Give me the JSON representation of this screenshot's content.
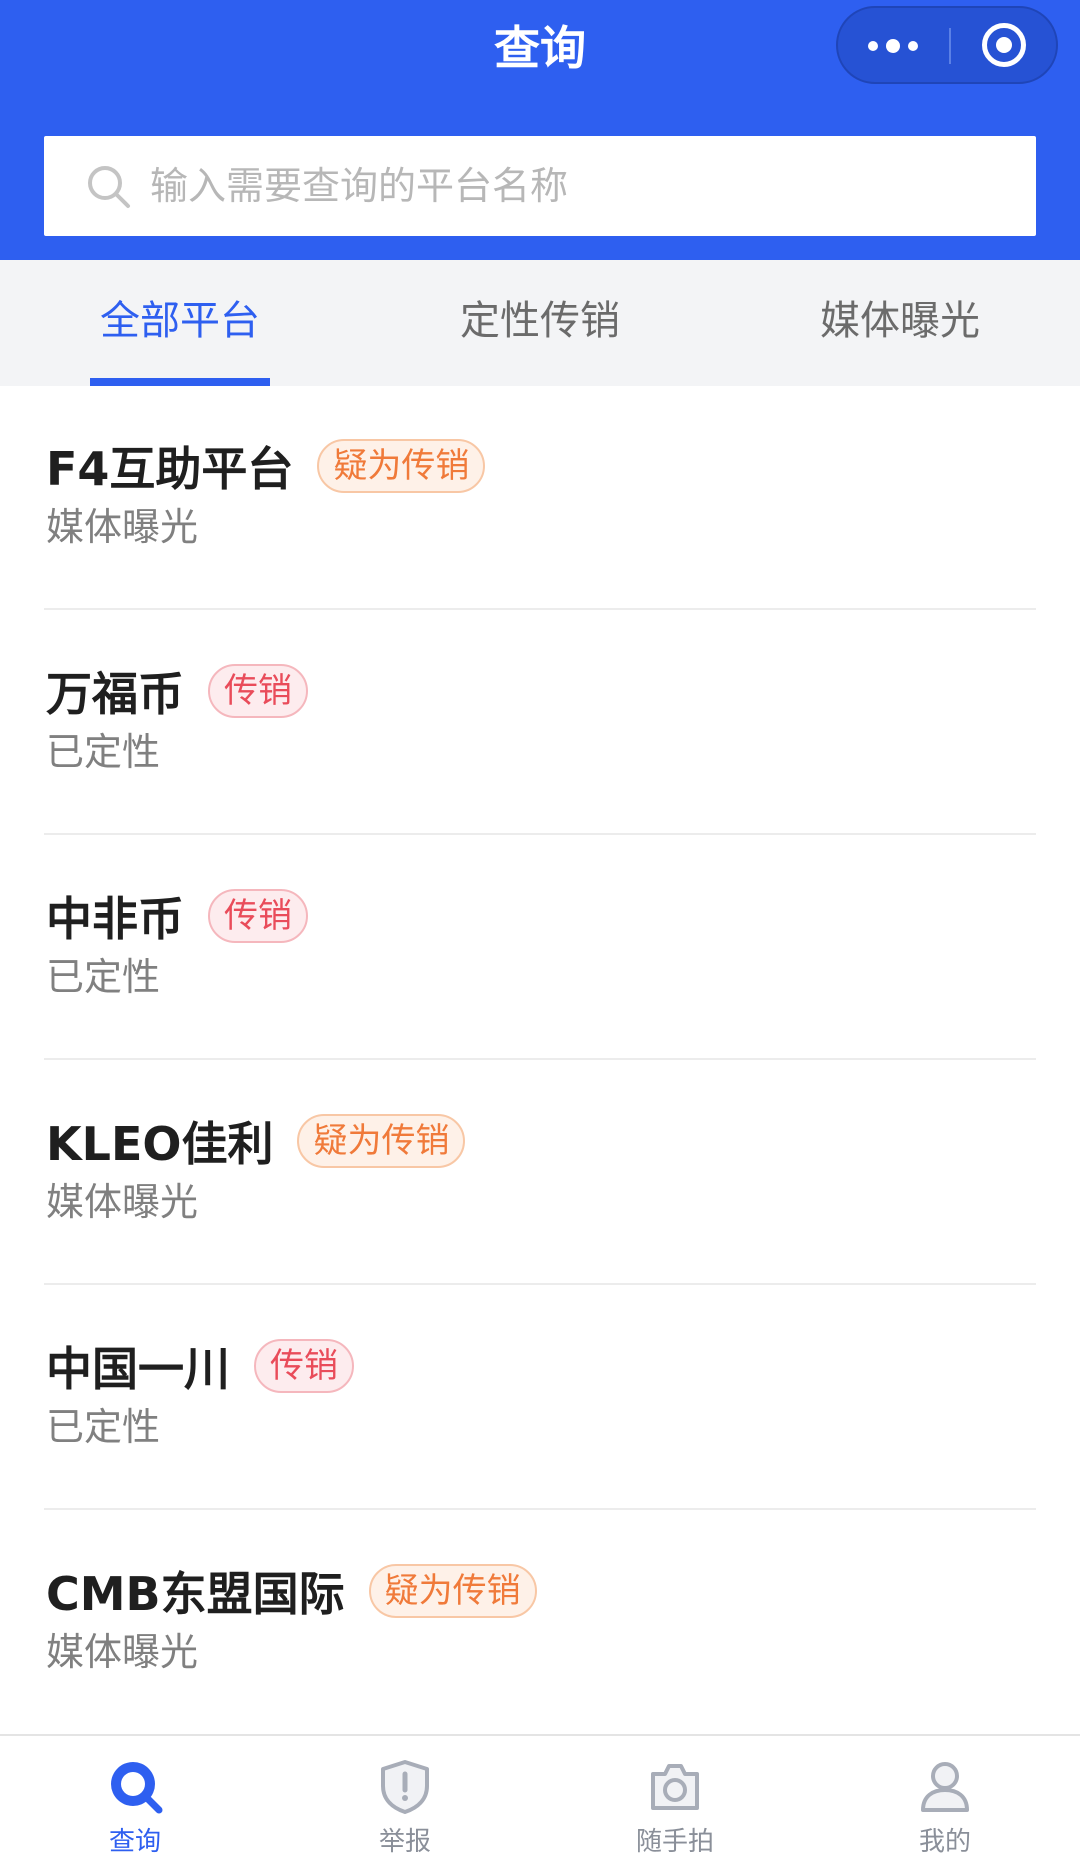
{
  "header": {
    "title": "查询",
    "search": {
      "placeholder": "输入需要查询的平台名称",
      "value": ""
    }
  },
  "tabs": [
    {
      "label": "全部平台",
      "active": true
    },
    {
      "label": "定性传销",
      "active": false
    },
    {
      "label": "媒体曝光",
      "active": false
    }
  ],
  "list": [
    {
      "name": "F4互助平台",
      "badge": "疑为传销",
      "badge_type": "suspect",
      "subtitle": "媒体曝光"
    },
    {
      "name": "万福币",
      "badge": "传销",
      "badge_type": "confirmed",
      "subtitle": "已定性"
    },
    {
      "name": "中非币",
      "badge": "传销",
      "badge_type": "confirmed",
      "subtitle": "已定性"
    },
    {
      "name": "KLEO佳利",
      "badge": "疑为传销",
      "badge_type": "suspect",
      "subtitle": "媒体曝光"
    },
    {
      "name": "中国一川",
      "badge": "传销",
      "badge_type": "confirmed",
      "subtitle": "已定性"
    },
    {
      "name": "CMB东盟国际",
      "badge": "疑为传销",
      "badge_type": "suspect",
      "subtitle": "媒体曝光"
    }
  ],
  "tabbar": [
    {
      "label": "查询",
      "icon": "search-icon",
      "active": true
    },
    {
      "label": "举报",
      "icon": "shield-alert-icon",
      "active": false
    },
    {
      "label": "随手拍",
      "icon": "camera-icon",
      "active": false
    },
    {
      "label": "我的",
      "icon": "user-icon",
      "active": false
    }
  ],
  "colors": {
    "primary": "#2e5ff0",
    "suspect_badge": "#f07a3a",
    "confirmed_badge": "#e94c5a",
    "inactive_text": "#8a8f99"
  }
}
